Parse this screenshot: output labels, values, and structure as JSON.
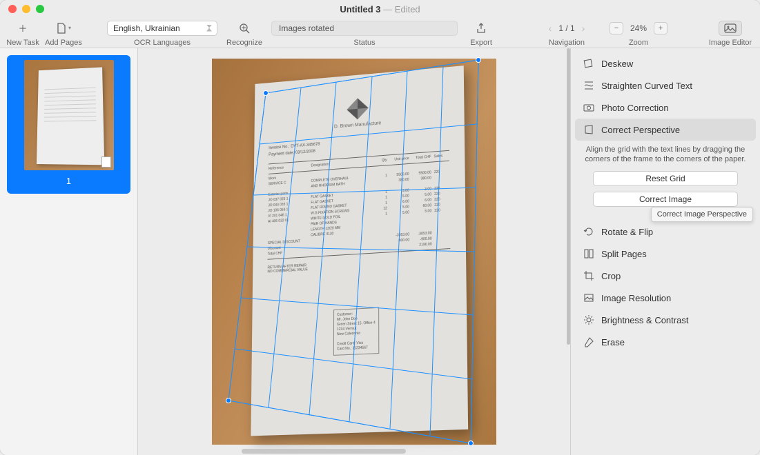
{
  "title": {
    "name": "Untitled 3",
    "status": "Edited"
  },
  "toolbar": {
    "newTask": "New Task",
    "addPages": "Add Pages",
    "ocrLanguages": "OCR Languages",
    "ocrLangValue": "English, Ukrainian",
    "recognize": "Recognize",
    "status": "Status",
    "statusValue": "Images rotated",
    "export": "Export",
    "navigation": "Navigation",
    "pageIndicator": "1 / 1",
    "zoom": "Zoom",
    "zoomValue": "24%",
    "imageEditor": "Image Editor"
  },
  "thumbs": {
    "page1": "1"
  },
  "doc": {
    "brand": "D. Brown Manufacture",
    "meta1": "Invoice No.: DVT-AX-345678",
    "meta2": "Payment date: 03/12/2008",
    "headers": [
      "Reference",
      "Designation",
      "Qty",
      "Unit price",
      "Total CHF",
      "Sales"
    ],
    "rows": [
      [
        "Work",
        "",
        "",
        "",
        "",
        ""
      ],
      [
        "SERVICE C",
        "COMPLETE OVERHAUL",
        "1",
        "5500.00",
        "5500.00",
        "220"
      ],
      [
        "",
        "AND RHODIUM BATH",
        "",
        "380.00",
        "380.00",
        ""
      ],
      [
        "Exterior parts",
        "",
        "",
        "",
        "",
        ""
      ],
      [
        "JO 037 025 1",
        "FLAT GASKET",
        "1",
        "3.00",
        "3.00",
        "220"
      ],
      [
        "JO 044 035 1",
        "FLAT GASKET",
        "1",
        "5.00",
        "5.00",
        "220"
      ],
      [
        "JO 106 059 1",
        "FLAT ROUND GASKET",
        "1",
        "6.00",
        "6.00",
        "220"
      ],
      [
        "VI 201 046 1",
        "W.G FIXATION SCREWS",
        "12",
        "5.00",
        "60.00",
        "220"
      ],
      [
        "AI 406 032 01",
        "WHITE GOLD FOIL",
        "1",
        "5.00",
        "5.00",
        "220"
      ],
      [
        "",
        "PAIR OF HANDS",
        "",
        "",
        "",
        ""
      ],
      [
        "",
        "LENGTH 13/20 MM",
        "",
        "",
        "",
        ""
      ],
      [
        "",
        "CALIBRE 4130",
        "",
        "",
        "",
        ""
      ],
      [
        "SPECIAL DISCOUNT",
        "",
        "",
        "-3053.00",
        "-3053.00",
        ""
      ],
      [
        "Discount",
        "",
        "",
        "-400.00",
        "-900.00",
        ""
      ],
      [
        "Total CHF",
        "",
        "",
        "",
        "2190.00",
        ""
      ]
    ],
    "after": [
      "RETURN AFTER REPAIR",
      "NO COMMERCIAL VALUE"
    ],
    "customer": [
      "Customer:",
      "Mr. John Doe",
      "Green Street 15, Office 4",
      "1234 Vermut",
      "New Caledonia",
      "",
      "Credit Card: Visa",
      "Card No.: 11234567"
    ]
  },
  "panel": {
    "deskew": "Deskew",
    "straighten": "Straighten Curved Text",
    "photo": "Photo Correction",
    "perspective": "Correct Perspective",
    "perspectiveHelp": "Align the grid with the text lines by dragging the corners of the frame to the corners of the paper.",
    "resetGrid": "Reset Grid",
    "correctImage": "Correct Image",
    "tooltip": "Correct Image Perspective",
    "rotateFlip": "Rotate & Flip",
    "split": "Split Pages",
    "crop": "Crop",
    "resolution": "Image Resolution",
    "brightness": "Brightness & Contrast",
    "erase": "Erase"
  }
}
